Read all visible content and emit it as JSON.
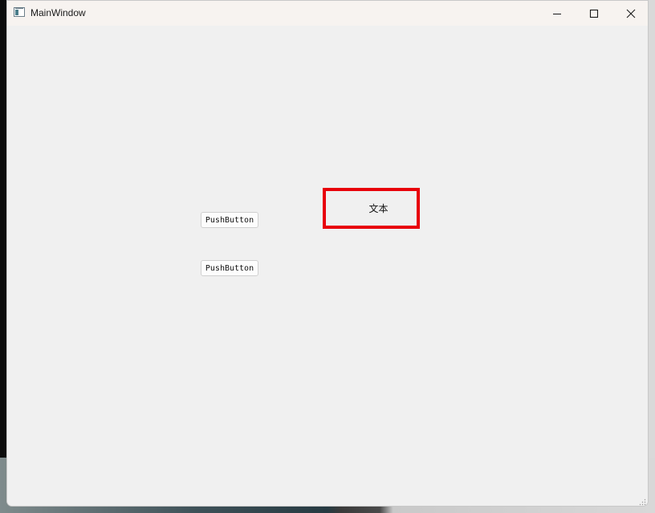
{
  "window": {
    "title": "MainWindow",
    "icon": "app-window-icon"
  },
  "caption_buttons": {
    "minimize": "minimize-icon",
    "maximize": "maximize-icon",
    "close": "close-icon"
  },
  "content": {
    "buttons": [
      {
        "label": "PushButton"
      },
      {
        "label": "PushButton"
      }
    ],
    "label_text": "文本",
    "label_border_color": "#e8000b"
  }
}
